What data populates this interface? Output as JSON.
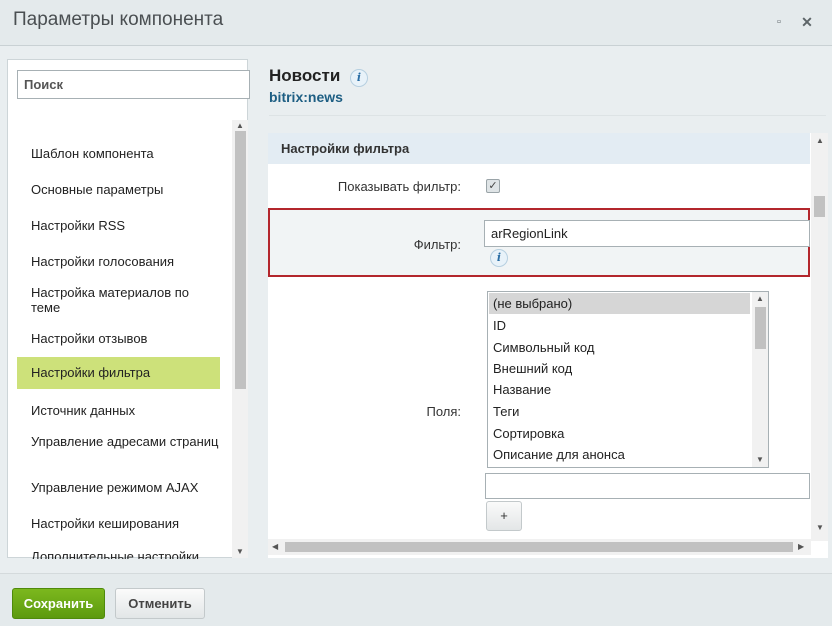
{
  "window": {
    "title": "Параметры компонента"
  },
  "sidebar": {
    "search_placeholder": "Поиск",
    "items": [
      {
        "label": "Шаблон компонента"
      },
      {
        "label": "Основные параметры"
      },
      {
        "label": "Настройки RSS"
      },
      {
        "label": "Настройки голосования"
      },
      {
        "label": "Настройка материалов по теме"
      },
      {
        "label": "Настройки отзывов"
      },
      {
        "label": "Настройки фильтра",
        "active": true
      },
      {
        "label": "Источник данных"
      },
      {
        "label": "Управление адресами страниц"
      },
      {
        "label": "Управление режимом AJAX"
      },
      {
        "label": "Настройки кеширования"
      },
      {
        "label": "Дополнительные настройки"
      }
    ]
  },
  "component": {
    "title": "Новости",
    "code": "bitrix:news"
  },
  "section": {
    "title": "Настройки фильтра",
    "show_filter_label": "Показывать фильтр:",
    "show_filter_checked": true,
    "filter_label": "Фильтр:",
    "filter_value": "arRegionLink",
    "fields_label": "Поля:",
    "fields_options": [
      {
        "label": "(не выбрано)",
        "selected": true
      },
      {
        "label": "ID"
      },
      {
        "label": "Символьный код"
      },
      {
        "label": "Внешний код"
      },
      {
        "label": "Название"
      },
      {
        "label": "Теги"
      },
      {
        "label": "Сортировка"
      },
      {
        "label": "Описание для анонса"
      }
    ],
    "add_button_label": "+"
  },
  "footer": {
    "save_label": "Сохранить",
    "cancel_label": "Отменить"
  },
  "colors": {
    "accent_green": "#6aa916",
    "active_item": "#cde17a",
    "highlight_border": "#b3262c"
  }
}
